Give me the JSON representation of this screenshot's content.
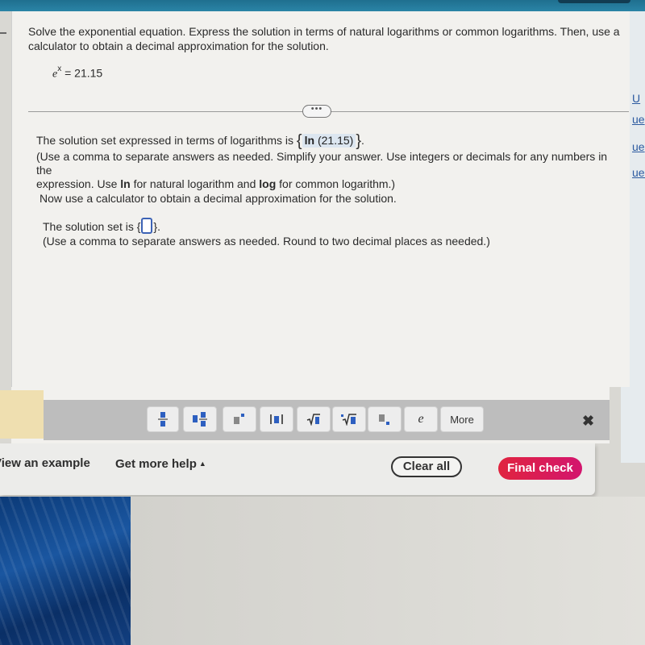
{
  "question": {
    "instructions": "Solve the exponential equation. Express the solution in terms of natural logarithms or common logarithms. Then, use a calculator to obtain a decimal approximation for the solution.",
    "equation": {
      "base": "e",
      "exponent": "x",
      "rhs": "= 21.15"
    },
    "expand_label": "•••"
  },
  "answer_part1": {
    "prefix": "The solution set expressed in terms of logarithms is",
    "open_brace": "{",
    "value_fn": "ln",
    "value_arg": "(21.15)",
    "close_brace": "}",
    "suffix": ".",
    "hint_line1": "(Use a comma to separate answers as needed. Simplify your answer. Use integers or decimals for any numbers in the",
    "hint_line2_a": "expression. Use ",
    "hint_line2_ln": "ln",
    "hint_line2_b": " for natural logarithm and ",
    "hint_line2_log": "log",
    "hint_line2_c": " for common logarithm.)"
  },
  "answer_part2": {
    "intro": "Now use a calculator to obtain a decimal approximation for the solution.",
    "prefix": "The solution set is",
    "open_brace": "{",
    "input_value": "",
    "close_brace": "}",
    "suffix": ".",
    "hint": "(Use a comma to separate answers as needed. Round to two decimal places as needed.)"
  },
  "palette": {
    "buttons": [
      {
        "name": "fraction"
      },
      {
        "name": "mixed-number"
      },
      {
        "name": "exponent"
      },
      {
        "name": "absolute-value"
      },
      {
        "name": "square-root"
      },
      {
        "name": "nth-root"
      },
      {
        "name": "subscript"
      },
      {
        "name": "e-constant",
        "label": "e"
      },
      {
        "name": "more",
        "label": "More"
      }
    ],
    "close_label": "✖"
  },
  "footer": {
    "view_example": "View an example",
    "get_more_help": "Get more help",
    "get_more_help_caret": "▲",
    "clear_all": "Clear all",
    "final_check": "Final check"
  },
  "right_strip_fragments": [
    "U",
    "ue",
    "ue",
    "ues"
  ],
  "colors": {
    "accent_blue": "#3d63b5",
    "final_check": "#e0243f",
    "top_bar": "#2a84a6"
  }
}
